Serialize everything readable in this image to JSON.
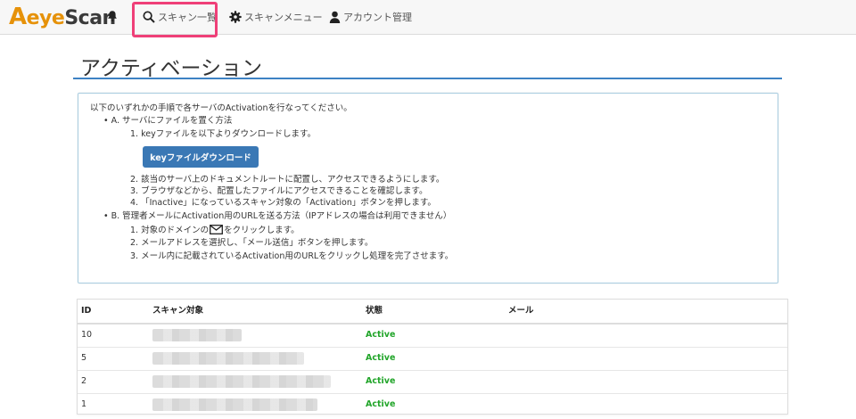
{
  "nav": {
    "logo": {
      "a": "A",
      "e": "eye",
      "rest": "Scan"
    },
    "icons": {
      "bell": "bell-icon",
      "search": "search-icon",
      "gear": "gear-icon",
      "person": "person-icon"
    },
    "items": [
      {
        "label": "スキャン一覧"
      },
      {
        "label": "スキャンメニュー"
      },
      {
        "label": "アカウント管理"
      }
    ],
    "highlight_color": "#ef3f78"
  },
  "page": {
    "title": "アクティベーション",
    "accent": "#3d82c4"
  },
  "instructions": {
    "intro": "以下のいずれかの手順で各サーバのActivationを行なってください。",
    "a_title": "A. サーバにファイルを置く方法",
    "a1": "1. keyファイルを以下よりダウンロードします。",
    "download_button": "keyファイルダウンロード",
    "a2": "2. 該当のサーバ上のドキュメントルートに配置し、アクセスできるようにします。",
    "a3": "3. ブラウザなどから、配置したファイルにアクセスできることを確認します。",
    "a4": "4. 「Inactive」になっているスキャン対象の「Activation」ボタンを押します。",
    "b_title": "B. 管理者メールにActivation用のURLを送る方法（IPアドレスの場合は利用できません）",
    "b1_pre": "1. 対象のドメインの",
    "b1_post": "をクリックします。",
    "b2": "2. メールアドレスを選択し、「メール送信」ボタンを押します。",
    "b3": "3. メール内に記載されているActivation用のURLをクリックし処理を完了させます。"
  },
  "table": {
    "headers": {
      "id": "ID",
      "target": "スキャン対象",
      "state": "状態",
      "mail": "メール"
    },
    "rows": [
      {
        "id": "10",
        "state": "Active"
      },
      {
        "id": "5",
        "state": "Active"
      },
      {
        "id": "2",
        "state": "Active"
      },
      {
        "id": "1",
        "state": "Active"
      }
    ],
    "active_color": "#22a52a"
  }
}
